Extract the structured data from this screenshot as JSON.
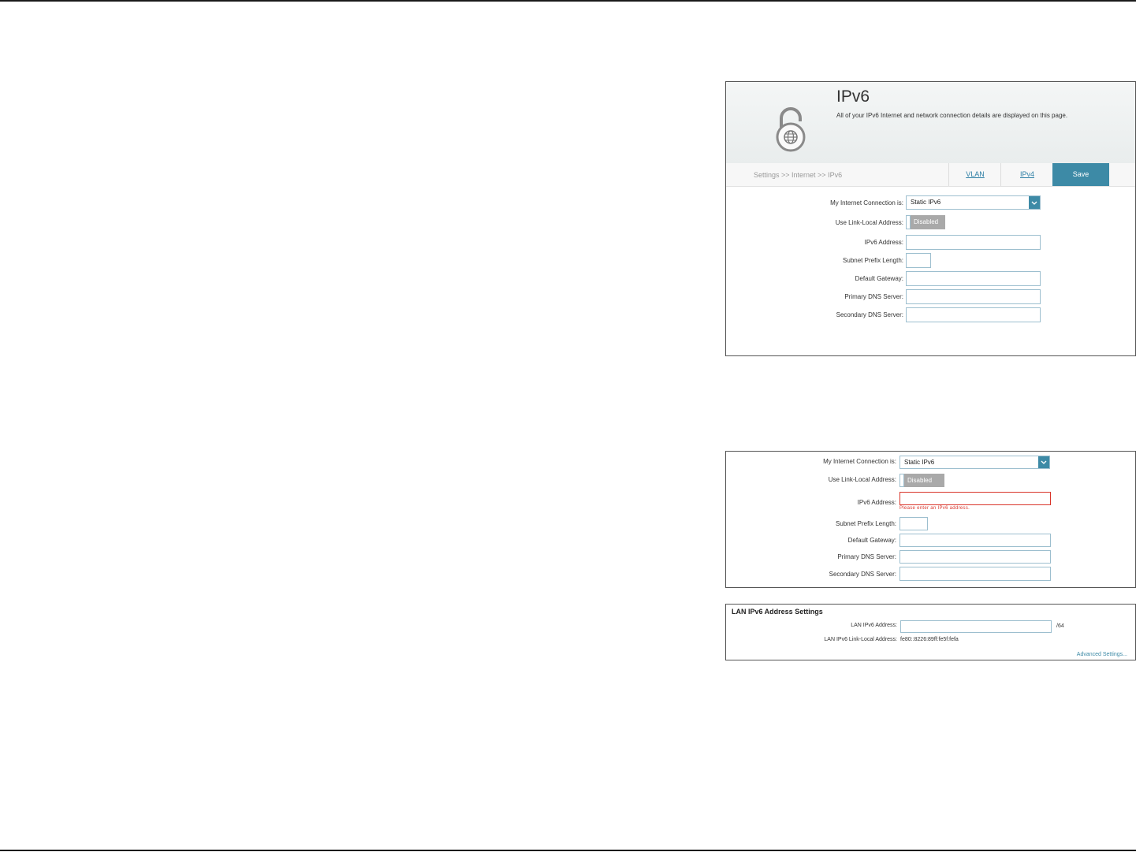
{
  "screen1": {
    "title": "IPv6",
    "description": "All of your IPv6 Internet and network connection details are displayed on this page.",
    "breadcrumb": "Settings >> Internet >> IPv6",
    "tabs": {
      "vlan": "VLAN",
      "ipv4": "IPv4"
    },
    "save_label": "Save",
    "form": {
      "connection_label": "My Internet Connection is:",
      "connection_value": "Static IPv6",
      "link_local_label": "Use Link-Local Address:",
      "link_local_state": "Disabled",
      "ipv6_address_label": "IPv6 Address:",
      "ipv6_address_value": "",
      "subnet_prefix_label": "Subnet Prefix Length:",
      "subnet_prefix_value": "",
      "default_gateway_label": "Default Gateway:",
      "default_gateway_value": "",
      "primary_dns_label": "Primary DNS Server:",
      "primary_dns_value": "",
      "secondary_dns_label": "Secondary DNS Server:",
      "secondary_dns_value": ""
    }
  },
  "screen2": {
    "connection_label": "My Internet Connection is:",
    "connection_value": "Static IPv6",
    "link_local_label": "Use Link-Local Address:",
    "link_local_state": "Disabled",
    "ipv6_address_label": "IPv6 Address:",
    "ipv6_error": "Please enter an IPv6 address.",
    "subnet_prefix_label": "Subnet Prefix Length:",
    "default_gateway_label": "Default Gateway:",
    "primary_dns_label": "Primary DNS Server:",
    "secondary_dns_label": "Secondary DNS Server:"
  },
  "screen3": {
    "heading": "LAN IPv6 Address Settings",
    "lan_ipv6_label": "LAN IPv6 Address:",
    "lan_ipv6_suffix": "/64",
    "link_local_label": "LAN IPv6 Link-Local Address:",
    "link_local_value": "fe80::8226:89ff:fe5f:fefa",
    "advanced_link": "Advanced Settings..."
  },
  "colors": {
    "accent": "#3d8aa6",
    "error": "#d9352b",
    "toggle_off": "#a9a9a9"
  }
}
